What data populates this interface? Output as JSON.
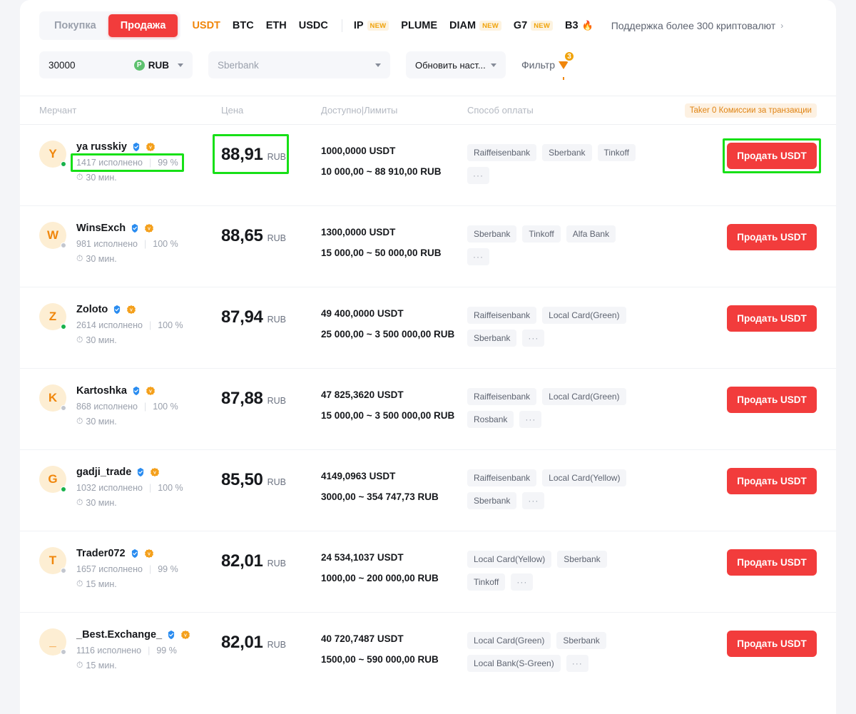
{
  "topbar": {
    "buy_label": "Покупка",
    "sell_label": "Продажа",
    "coins": [
      "USDT",
      "BTC",
      "ETH",
      "USDC"
    ],
    "alt_tokens": [
      {
        "label": "IP",
        "badge": "NEW",
        "fire": false
      },
      {
        "label": "PLUME",
        "badge": "",
        "fire": false
      },
      {
        "label": "DIAM",
        "badge": "NEW",
        "fire": false
      },
      {
        "label": "G7",
        "badge": "NEW",
        "fire": false
      },
      {
        "label": "B3",
        "badge": "",
        "fire": true
      }
    ],
    "support_text": "Поддержка более 300 криптовалют",
    "support_chevron": "›",
    "selected_coin": "USDT",
    "accent_color": "#f0860b",
    "sell_color": "#f23c3c"
  },
  "filters": {
    "amount_value": "30000",
    "currency_icon_letter": "P",
    "currency_label": "RUB",
    "bank_placeholder": "Sberbank",
    "settings_label": "Обновить наст...",
    "filter_label": "Фильтр",
    "filter_count": "3"
  },
  "table": {
    "headers": {
      "merchant": "Мерчант",
      "price": "Цена",
      "available": "Доступно|Лимиты",
      "payment": "Способ оплаты",
      "taker_badge": "Taker 0 Комиссии за транзакции"
    },
    "rows": [
      {
        "avatar_letter": "Y",
        "online": true,
        "name": "ya russkiy",
        "orders": "1417 исполнено",
        "separator": "|",
        "completion": "99 %",
        "time": "30 мин.",
        "price": "88,91",
        "price_currency": "RUB",
        "available": "1000,0000 USDT",
        "limits": "10 000,00 ~ 88 910,00 RUB",
        "tags": [
          "Raiffeisenbank",
          "Sberbank",
          "Tinkoff"
        ],
        "more": "···",
        "action": "Продать USDT",
        "highlight_stats": true,
        "highlight_price": true,
        "highlight_button": true
      },
      {
        "avatar_letter": "W",
        "online": false,
        "name": "WinsExch",
        "orders": "981 исполнено",
        "separator": "|",
        "completion": "100 %",
        "time": "30 мин.",
        "price": "88,65",
        "price_currency": "RUB",
        "available": "1300,0000 USDT",
        "limits": "15 000,00 ~ 50 000,00 RUB",
        "tags": [
          "Sberbank",
          "Tinkoff",
          "Alfa Bank"
        ],
        "more": "···",
        "action": "Продать USDT",
        "highlight_stats": false,
        "highlight_price": false,
        "highlight_button": false
      },
      {
        "avatar_letter": "Z",
        "online": true,
        "name": "Zoloto",
        "orders": "2614 исполнено",
        "separator": "|",
        "completion": "100 %",
        "time": "30 мин.",
        "price": "87,94",
        "price_currency": "RUB",
        "available": "49 400,0000 USDT",
        "limits": "25 000,00 ~ 3 500 000,00 RUB",
        "tags": [
          "Raiffeisenbank",
          "Local Card(Green)",
          "Sberbank"
        ],
        "more": "···",
        "action": "Продать USDT",
        "highlight_stats": false,
        "highlight_price": false,
        "highlight_button": false
      },
      {
        "avatar_letter": "K",
        "online": false,
        "name": "Kartoshka",
        "orders": "868 исполнено",
        "separator": "|",
        "completion": "100 %",
        "time": "30 мин.",
        "price": "87,88",
        "price_currency": "RUB",
        "available": "47 825,3620 USDT",
        "limits": "15 000,00 ~ 3 500 000,00 RUB",
        "tags": [
          "Raiffeisenbank",
          "Local Card(Green)",
          "Rosbank"
        ],
        "more": "···",
        "action": "Продать USDT",
        "highlight_stats": false,
        "highlight_price": false,
        "highlight_button": false
      },
      {
        "avatar_letter": "G",
        "online": true,
        "name": "gadji_trade",
        "orders": "1032 исполнено",
        "separator": "|",
        "completion": "100 %",
        "time": "30 мин.",
        "price": "85,50",
        "price_currency": "RUB",
        "available": "4149,0963 USDT",
        "limits": "3000,00 ~ 354 747,73 RUB",
        "tags": [
          "Raiffeisenbank",
          "Local Card(Yellow)",
          "Sberbank"
        ],
        "more": "···",
        "action": "Продать USDT",
        "highlight_stats": false,
        "highlight_price": false,
        "highlight_button": false
      },
      {
        "avatar_letter": "T",
        "online": false,
        "name": "Trader072",
        "orders": "1657 исполнено",
        "separator": "|",
        "completion": "99 %",
        "time": "15 мин.",
        "price": "82,01",
        "price_currency": "RUB",
        "available": "24 534,1037 USDT",
        "limits": "1000,00 ~ 200 000,00 RUB",
        "tags": [
          "Local Card(Yellow)",
          "Sberbank",
          "Tinkoff"
        ],
        "more": "···",
        "action": "Продать USDT",
        "highlight_stats": false,
        "highlight_price": false,
        "highlight_button": false
      },
      {
        "avatar_letter": "_",
        "online": false,
        "name": "_Best.Exchange_",
        "orders": "1116 исполнено",
        "separator": "|",
        "completion": "99 %",
        "time": "15 мин.",
        "price": "82,01",
        "price_currency": "RUB",
        "available": "40 720,7487 USDT",
        "limits": "1500,00 ~ 590 000,00 RUB",
        "tags": [
          "Local Card(Green)",
          "Sberbank",
          "Local Bank(S-Green)"
        ],
        "more": "···",
        "action": "Продать USDT",
        "highlight_stats": false,
        "highlight_price": false,
        "highlight_button": false
      }
    ]
  }
}
